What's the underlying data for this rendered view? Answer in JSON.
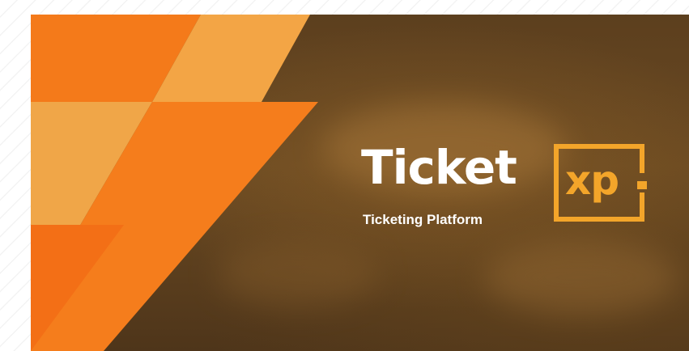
{
  "brand": {
    "name": "Ticket",
    "badge_text": "xp",
    "tagline": "Ticketing Platform"
  },
  "colors": {
    "brand_orange": "#f3a52a",
    "shape_orange": "#f47a1a",
    "shape_light_orange": "#f3a545",
    "background_brown": "#5c3f1e"
  },
  "icons": {
    "logo_badge": "xp-bracket-logo-icon"
  }
}
